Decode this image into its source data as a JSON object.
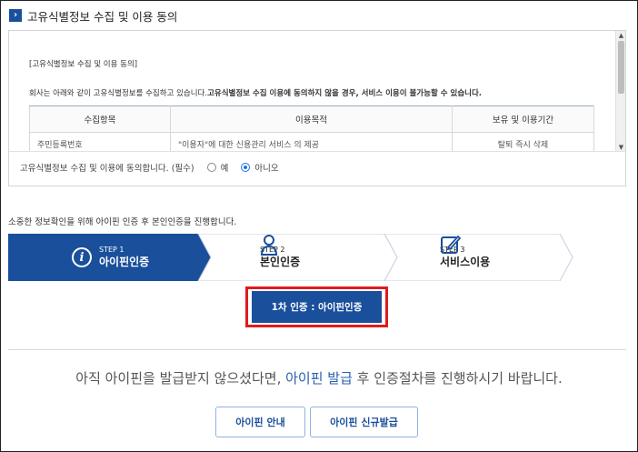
{
  "section": {
    "chevron": "chevron-right-icon",
    "title": "고유식별정보 수집 및 이용 동의"
  },
  "terms": {
    "title": "[고유식별정보 수집 및 이용 동의]",
    "desc_normal": "회사는 아래와 같이 고유식별정보를 수집하고 있습니다.",
    "desc_bold": "고유식별정보 수집 이용에 동의하지 않을 경우, 서비스 이용이 불가능할 수 있습니다.",
    "table": {
      "headers": [
        "수집항목",
        "이용목적",
        "보유 및 이용기간"
      ],
      "rows": [
        [
          "주민등록번호",
          "\"이용자\"에 대한 신용관리 서비스 의 제공",
          "탈퇴 즉시 삭제"
        ]
      ]
    }
  },
  "agreement": {
    "question": "고유식별정보 수집 및 이용에 동의합니다. (필수)",
    "options": [
      {
        "label": "예",
        "checked": false
      },
      {
        "label": "아니오",
        "checked": true
      }
    ]
  },
  "info_text": "소중한 정보확인을 위해 아이핀 인증 후 본인인증을 진행합니다.",
  "steps": [
    {
      "num": "STEP 1",
      "name": "아이핀인증",
      "icon": "info-circle-icon",
      "active": true
    },
    {
      "num": "STEP 2",
      "name": "본인인증",
      "icon": "person-icon",
      "active": false
    },
    {
      "num": "STEP 3",
      "name": "서비스이용",
      "icon": "edit-icon",
      "active": false
    }
  ],
  "auth_button": "1차 인증 : 아이핀인증",
  "guide": {
    "prefix": "아직 아이핀을 발급받지 않으셨다면, ",
    "link": "아이핀 발급",
    "suffix": " 후 인증절차를 진행하시기 바랍니다."
  },
  "buttons": {
    "guide": "아이핀 안내",
    "issue": "아이핀 신규발급"
  },
  "colors": {
    "primary": "#1a4f9c",
    "highlight": "#e11b1b",
    "link": "#2a5fb0"
  }
}
